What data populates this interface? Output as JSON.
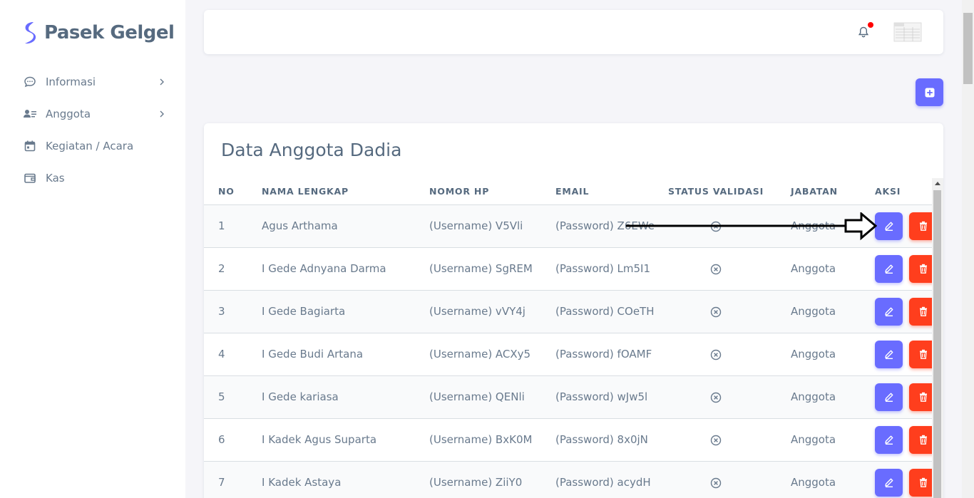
{
  "brand": {
    "name": "Pasek Gelgel",
    "color": "#696cff"
  },
  "sidebar": {
    "items": [
      {
        "label": "Informasi",
        "icon": "chat-bubble-icon",
        "has_submenu": true
      },
      {
        "label": "Anggota",
        "icon": "user-list-icon",
        "has_submenu": true
      },
      {
        "label": "Kegiatan / Acara",
        "icon": "calendar-icon",
        "has_submenu": false
      },
      {
        "label": "Kas",
        "icon": "wallet-icon",
        "has_submenu": false
      }
    ]
  },
  "navbar": {
    "notification_icon": "bell-icon",
    "has_unread": true,
    "avatar_icon": "avatar-thumbnail"
  },
  "add_button": {
    "icon": "plus-square-icon"
  },
  "card": {
    "title": "Data Anggota Dadia",
    "columns": [
      "NO",
      "NAMA LENGKAP",
      "NOMOR HP",
      "EMAIL",
      "STATUS VALIDASI",
      "JABATAN",
      "AKSI"
    ],
    "rows": [
      {
        "no": "1",
        "nama": "Agus Arthama",
        "hp": "(Username) V5Vli",
        "email": "(Password) Z6EWe",
        "status_icon": "x-circle-icon",
        "jabatan": "Anggota"
      },
      {
        "no": "2",
        "nama": "I Gede Adnyana Darma",
        "hp": "(Username) SgREM",
        "email": "(Password) Lm5I1",
        "status_icon": "x-circle-icon",
        "jabatan": "Anggota"
      },
      {
        "no": "3",
        "nama": "I Gede Bagiarta",
        "hp": "(Username) vVY4j",
        "email": "(Password) COeTH",
        "status_icon": "x-circle-icon",
        "jabatan": "Anggota"
      },
      {
        "no": "4",
        "nama": "I Gede Budi Artana",
        "hp": "(Username) ACXy5",
        "email": "(Password) fOAMF",
        "status_icon": "x-circle-icon",
        "jabatan": "Anggota"
      },
      {
        "no": "5",
        "nama": "I Gede kariasa",
        "hp": "(Username) QENli",
        "email": "(Password) wJw5l",
        "status_icon": "x-circle-icon",
        "jabatan": "Anggota"
      },
      {
        "no": "6",
        "nama": "I Kadek Agus Suparta",
        "hp": "(Username) BxK0M",
        "email": "(Password) 8x0jN",
        "status_icon": "x-circle-icon",
        "jabatan": "Anggota"
      },
      {
        "no": "7",
        "nama": "I Kadek Astaya",
        "hp": "(Username) ZiiY0",
        "email": "(Password) acydH",
        "status_icon": "x-circle-icon",
        "jabatan": "Anggota"
      }
    ],
    "actions": {
      "edit_icon": "pencil-icon",
      "delete_icon": "trash-icon",
      "edit_color": "#696cff",
      "delete_color": "#ff3e1d"
    }
  }
}
